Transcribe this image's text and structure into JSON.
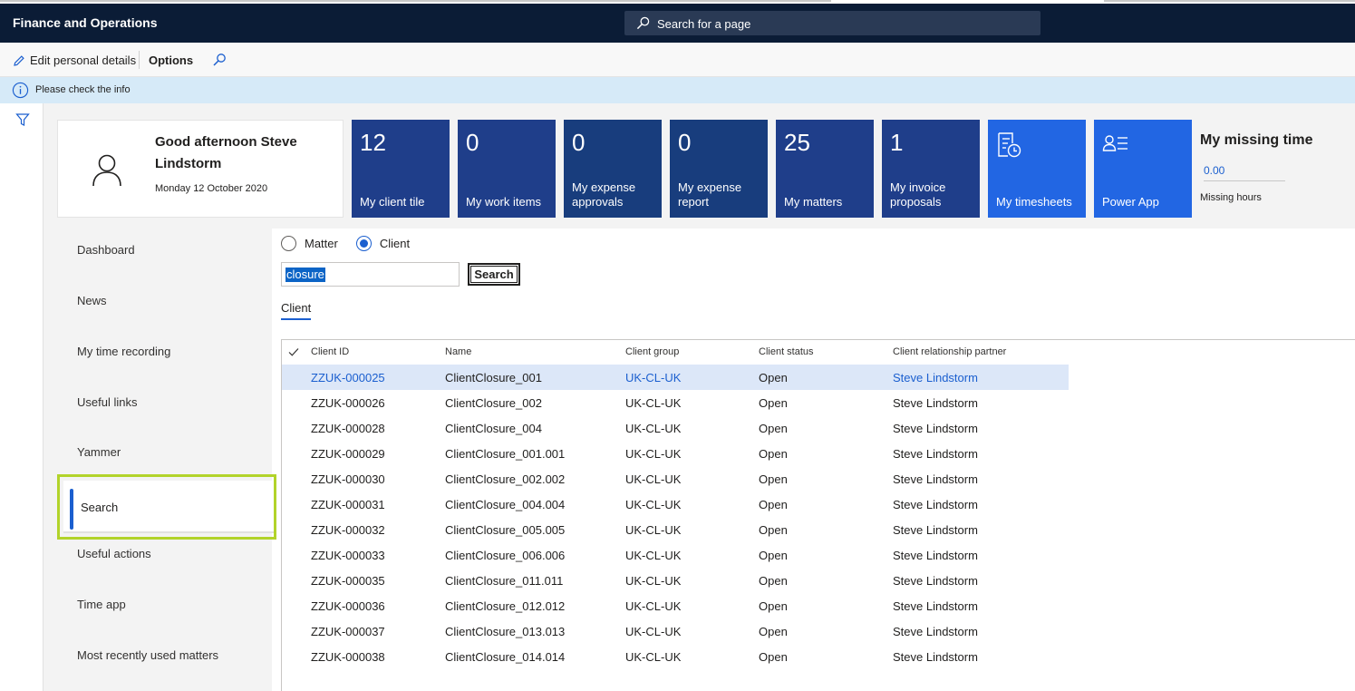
{
  "navbar": {
    "title": "Finance and Operations",
    "search_placeholder": "Search for a page"
  },
  "actionpane": {
    "edit_label": "Edit personal details",
    "options_label": "Options"
  },
  "infobar": {
    "message": "Please check the info"
  },
  "welcome": {
    "greeting": "Good afternoon Steve Lindstorm",
    "date": "Monday 12 October 2020"
  },
  "tiles": [
    {
      "count": "12",
      "label": "My client tile"
    },
    {
      "count": "0",
      "label": "My work items"
    },
    {
      "count": "0",
      "label": "My expense approvals"
    },
    {
      "count": "0",
      "label": "My expense report"
    },
    {
      "count": "25",
      "label": "My matters"
    },
    {
      "count": "1",
      "label": "My invoice proposals"
    },
    {
      "icon": "timesheet-icon",
      "label": "My timesheets"
    },
    {
      "icon": "power-app-icon",
      "label": "Power App"
    }
  ],
  "missing_time": {
    "title": "My missing time",
    "value": "0.00",
    "label": "Missing hours"
  },
  "nav": {
    "items": [
      "Dashboard",
      "News",
      "My time recording",
      "Useful links",
      "Yammer",
      "Search",
      "Useful actions",
      "Time app",
      "Most recently used matters"
    ],
    "selected": "Search"
  },
  "search": {
    "radio_matter": "Matter",
    "radio_client": "Client",
    "selected_radio": "Client",
    "query": "closure",
    "button_label": "Search",
    "tab_label": "Client"
  },
  "grid": {
    "columns": [
      "Client ID",
      "Name",
      "Client group",
      "Client status",
      "Client relationship partner"
    ],
    "rows": [
      [
        "ZZUK-000025",
        "ClientClosure_001",
        "UK-CL-UK",
        "Open",
        "Steve Lindstorm"
      ],
      [
        "ZZUK-000026",
        "ClientClosure_002",
        "UK-CL-UK",
        "Open",
        "Steve Lindstorm"
      ],
      [
        "ZZUK-000028",
        "ClientClosure_004",
        "UK-CL-UK",
        "Open",
        "Steve Lindstorm"
      ],
      [
        "ZZUK-000029",
        "ClientClosure_001.001",
        "UK-CL-UK",
        "Open",
        "Steve Lindstorm"
      ],
      [
        "ZZUK-000030",
        "ClientClosure_002.002",
        "UK-CL-UK",
        "Open",
        "Steve Lindstorm"
      ],
      [
        "ZZUK-000031",
        "ClientClosure_004.004",
        "UK-CL-UK",
        "Open",
        "Steve Lindstorm"
      ],
      [
        "ZZUK-000032",
        "ClientClosure_005.005",
        "UK-CL-UK",
        "Open",
        "Steve Lindstorm"
      ],
      [
        "ZZUK-000033",
        "ClientClosure_006.006",
        "UK-CL-UK",
        "Open",
        "Steve Lindstorm"
      ],
      [
        "ZZUK-000035",
        "ClientClosure_011.011",
        "UK-CL-UK",
        "Open",
        "Steve Lindstorm"
      ],
      [
        "ZZUK-000036",
        "ClientClosure_012.012",
        "UK-CL-UK",
        "Open",
        "Steve Lindstorm"
      ],
      [
        "ZZUK-000037",
        "ClientClosure_013.013",
        "UK-CL-UK",
        "Open",
        "Steve Lindstorm"
      ],
      [
        "ZZUK-000038",
        "ClientClosure_014.014",
        "UK-CL-UK",
        "Open",
        "Steve Lindstorm"
      ]
    ],
    "selected_row": 0
  },
  "colors": {
    "navbar": "#0b1c36",
    "tile": "#1f3e8a",
    "tile_bright": "#2266e3",
    "accent": "#1b5fcf",
    "highlight_box": "#b2d32a",
    "selected_row": "#dce7f8"
  }
}
